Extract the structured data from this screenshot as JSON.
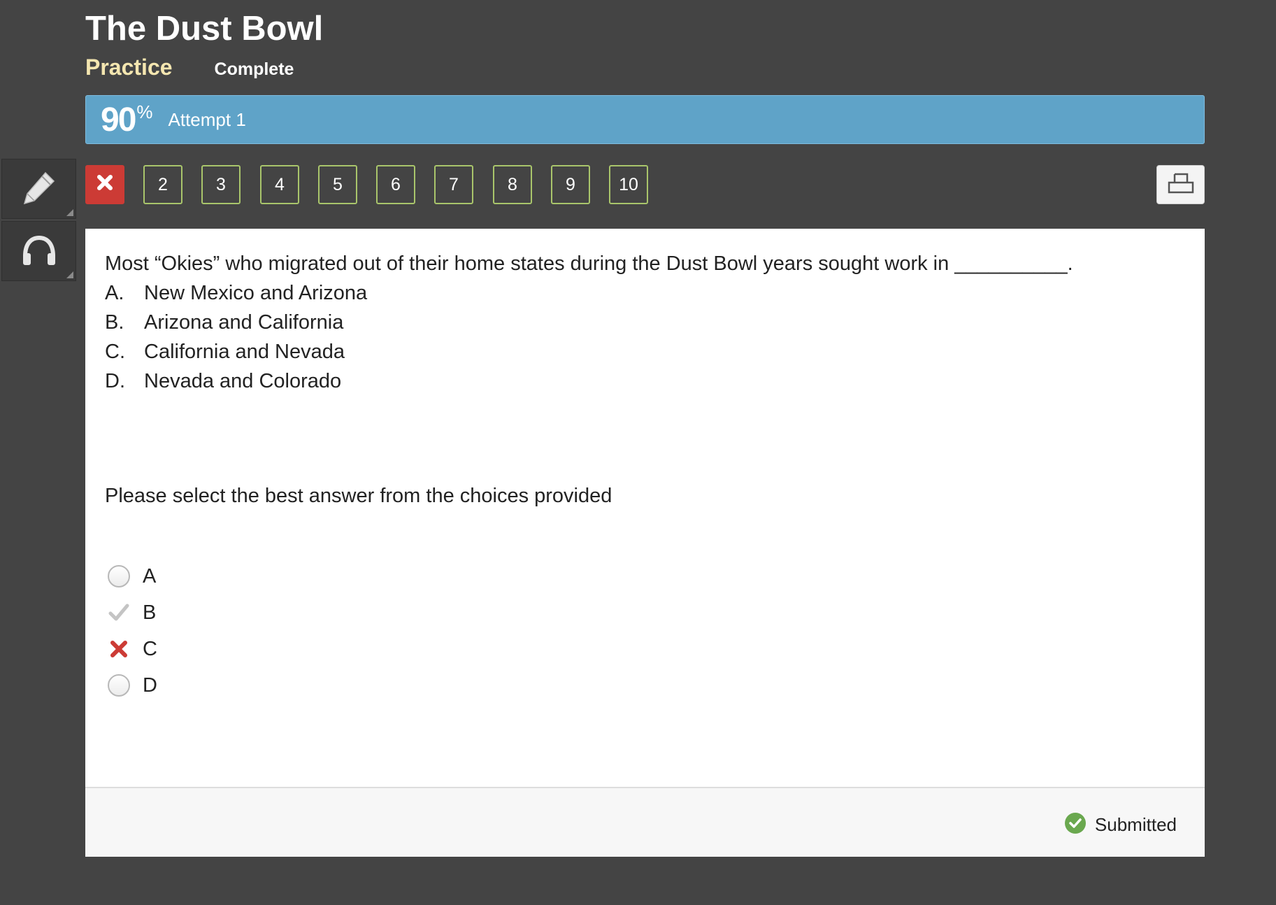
{
  "header": {
    "title": "The Dust Bowl",
    "tabs": [
      {
        "label": "Practice",
        "active": true
      },
      {
        "label": "Complete",
        "active": false
      }
    ]
  },
  "score": {
    "value": "90",
    "unit": "%",
    "attempt_label": "Attempt 1",
    "bar_color": "#5fa3c8"
  },
  "tools": [
    {
      "icon": "pencil-icon"
    },
    {
      "icon": "headphones-icon"
    }
  ],
  "question_nav": {
    "items": [
      {
        "label": "",
        "status": "incorrect",
        "icon": "x-icon"
      },
      {
        "label": "2"
      },
      {
        "label": "3"
      },
      {
        "label": "4"
      },
      {
        "label": "5"
      },
      {
        "label": "6"
      },
      {
        "label": "7"
      },
      {
        "label": "8"
      },
      {
        "label": "9"
      },
      {
        "label": "10"
      }
    ],
    "print_icon": "print-icon"
  },
  "question": {
    "text": "Most “Okies” who migrated out of their home states during the Dust Bowl years sought work in __________.",
    "choices": [
      {
        "letter": "A.",
        "text": "New Mexico and Arizona"
      },
      {
        "letter": "B.",
        "text": "Arizona and California"
      },
      {
        "letter": "C.",
        "text": "California and Nevada"
      },
      {
        "letter": "D.",
        "text": "Nevada and Colorado"
      }
    ],
    "instruction": "Please select the best answer from the choices provided"
  },
  "answers": [
    {
      "label": "A",
      "state": "unselected"
    },
    {
      "label": "B",
      "state": "correct-answer"
    },
    {
      "label": "C",
      "state": "selected-incorrect"
    },
    {
      "label": "D",
      "state": "unselected"
    }
  ],
  "footer": {
    "status_label": "Submitted",
    "status_color": "#6aa84f"
  },
  "colors": {
    "background": "#444444",
    "practice_tab": "#f4e6b0",
    "nav_border": "#a9c56b",
    "incorrect": "#cc3b35"
  }
}
